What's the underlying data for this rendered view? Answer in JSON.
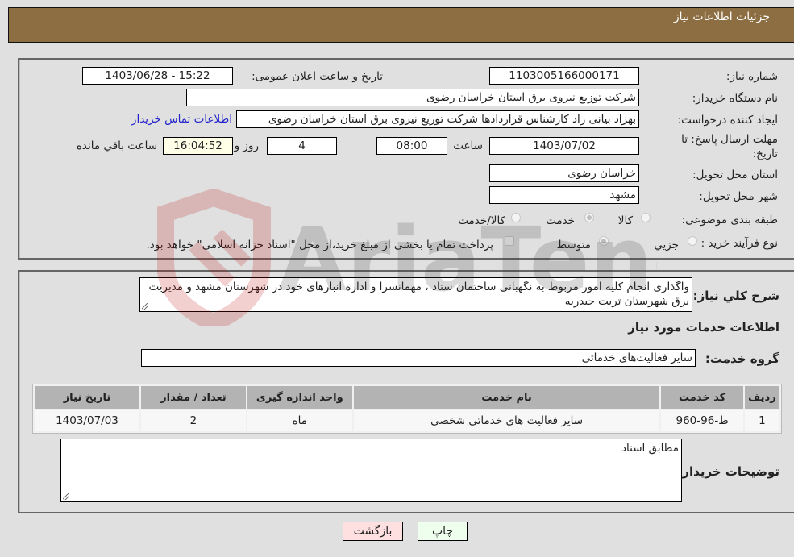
{
  "header": {
    "title": "جزئیات اطلاعات نیاز"
  },
  "form": {
    "need_number_label": "شماره نیاز:",
    "need_number": "1103005166000171",
    "announce_label": "تاریخ و ساعت اعلان عمومی:",
    "announce_value": "1403/06/28 - 15:22",
    "buyer_org_label": "نام دستگاه خریدار:",
    "buyer_org": "شرکت توزیع نیروی برق استان خراسان رضوی",
    "creator_label": "ایجاد کننده درخواست:",
    "creator": "بهزاد بیانی راد کارشناس قراردادها شرکت توزیع نیروی برق استان خراسان رضوی",
    "contact_link": "اطلاعات تماس خریدار",
    "deadline_label": "مهلت ارسال پاسخ: تا تاریخ:",
    "deadline_date": "1403/07/02",
    "time_label": "ساعت",
    "deadline_time": "08:00",
    "days_value": "4",
    "days_label": "روز و",
    "remaining_time": "16:04:52",
    "remaining_label": "ساعت باقي مانده",
    "province_label": "استان محل تحویل:",
    "province": "خراسان رضوی",
    "city_label": "شهر محل تحویل:",
    "city": "مشهد",
    "category_label": "طبقه بندی موضوعی:",
    "category_options": [
      {
        "label": "کالا",
        "checked": false
      },
      {
        "label": "خدمت",
        "checked": true
      },
      {
        "label": "کالا/خدمت",
        "checked": false
      }
    ],
    "process_label": "نوع فرآیند خرید :",
    "process_options": [
      {
        "label": "جزيي",
        "checked": false
      },
      {
        "label": "متوسط",
        "checked": true
      }
    ],
    "treasury_checkbox_label": "پرداخت تمام یا بخشی از مبلغ خرید،از محل \"اسناد خزانه اسلامی\" خواهد بود."
  },
  "details": {
    "description_label": "شرح كلي نياز:",
    "description": "واگذاری انجام کلیه امور مربوط به نگهبانی ساختمان ستاد ، مهمانسرا و اداره انبارهای خود در شهرستان مشهد و مدیریت برق شهرستان تربت حیدریه",
    "services_title": "اطلاعات خدمات مورد نیاز",
    "service_group_label": "گروه خدمت:",
    "service_group": "سایر فعالیت‌های خدماتی",
    "table": {
      "headers": [
        "ردیف",
        "کد خدمت",
        "نام خدمت",
        "واحد اندازه گیری",
        "تعداد / مقدار",
        "تاریخ نیاز"
      ],
      "rows": [
        [
          "1",
          "ط-96-960",
          "سایر فعالیت های خدماتی شخصی",
          "ماه",
          "2",
          "1403/07/03"
        ]
      ]
    },
    "buyer_notes_label": "توضیحات خریدار:",
    "buyer_notes": "مطابق اسناد"
  },
  "buttons": {
    "print": "چاپ",
    "back": "بازگشت"
  },
  "watermark": "AriaTender.neT",
  "colors": {
    "header": "#8d6e43",
    "print_bg": "#eeffee",
    "back_bg": "#ffe0e0",
    "link": "#2222cc"
  }
}
